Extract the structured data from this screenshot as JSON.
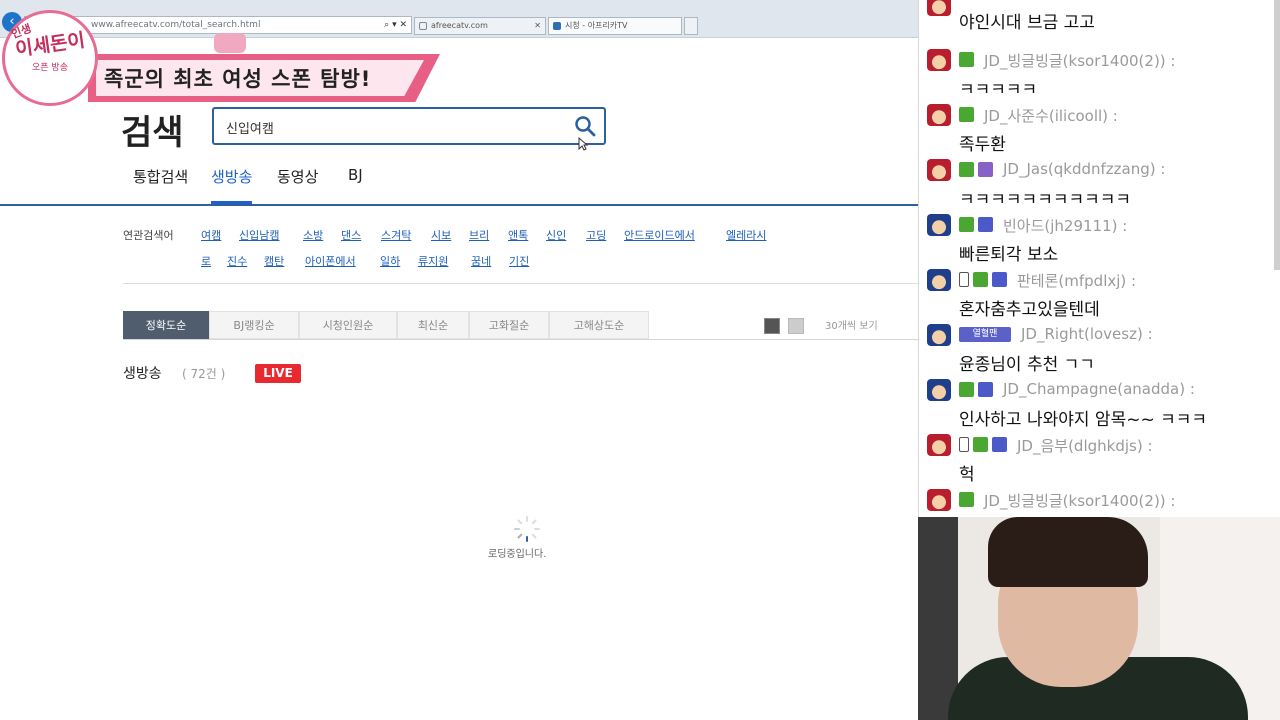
{
  "browser": {
    "address": "www.afreecatv.com/total_search.html",
    "tabs": [
      {
        "label": "afreecatv.com"
      },
      {
        "label": "시청 - 아프리카TV"
      }
    ]
  },
  "overlay": {
    "logo_text": "이세돈이",
    "logo_top": "인생",
    "logo_sub": "오픈 방송",
    "banner_text": "족군의 최초 여성 스폰 탐방!"
  },
  "search": {
    "title": "검색",
    "query": "신입여캠",
    "tabs": [
      "통합검색",
      "생방송",
      "동영상",
      "BJ"
    ],
    "active_tab": 1
  },
  "related": {
    "label": "연관검색어",
    "row1": [
      "여캠",
      "신입남캠",
      "소방",
      "댄스",
      "스겨탁",
      "시보",
      "브리",
      "앤톡",
      "신인",
      "고딩",
      "안드로이드에서",
      "엘레라시"
    ],
    "row2": [
      "로",
      "진수",
      "캠탄",
      "아이폰에서",
      "일하",
      "류지원",
      "꿈네",
      "기진"
    ]
  },
  "sort": {
    "options": [
      "정확도순",
      "BJ랭킹순",
      "시청인원순",
      "최신순",
      "고화질순",
      "고해상도순"
    ],
    "per_page": "30개씩 보기"
  },
  "results": {
    "section": "생방송",
    "count": "( 72건 )",
    "live_badge": "LIVE",
    "loading": "로딩중입니다."
  },
  "chat": {
    "messages": [
      {
        "user": "",
        "text": "야인시대 브금 고고",
        "avatar": "red",
        "badges": []
      },
      {
        "user": "JD_빙글빙글(ksor1400(2)) :",
        "text": "ㅋㅋㅋㅋㅋ",
        "avatar": "red",
        "badges": [
          "green"
        ]
      },
      {
        "user": "JD_사준수(ilicooll) :",
        "text": "족두환",
        "avatar": "red",
        "badges": [
          "green"
        ]
      },
      {
        "user": "JD_Jas(qkddnfzzang) :",
        "text": "ㅋㅋㅋㅋㅋㅋㅋㅋㅋㅋㅋ",
        "avatar": "red",
        "badges": [
          "green",
          "purple"
        ]
      },
      {
        "user": "빈아드(jh29111) :",
        "text": "빠른퇴각 보소",
        "avatar": "blue",
        "badges": [
          "green",
          "blue"
        ]
      },
      {
        "user": "판테론(mfpdlxj) :",
        "text": "혼자춤추고있을텐데",
        "avatar": "blue",
        "badges": [
          "phone",
          "green",
          "blue"
        ]
      },
      {
        "user": "JD_Right(lovesz) :",
        "text": "윤종님이 추천 ㄱㄱ",
        "avatar": "blue",
        "badges": [
          "fan"
        ]
      },
      {
        "user": "JD_Champagne(anadda) :",
        "text": "인사하고 나와야지 암목~~ ㅋㅋㅋ",
        "avatar": "blue",
        "badges": [
          "green",
          "blue"
        ]
      },
      {
        "user": "JD_음부(dlghkdjs) :",
        "text": "헉",
        "avatar": "red",
        "badges": [
          "phone",
          "green",
          "blue"
        ]
      },
      {
        "user": "JD_빙글빙글(ksor1400(2)) :",
        "text": "",
        "avatar": "red",
        "badges": [
          "green"
        ]
      }
    ],
    "fan_badge_label": "열혈팬"
  }
}
